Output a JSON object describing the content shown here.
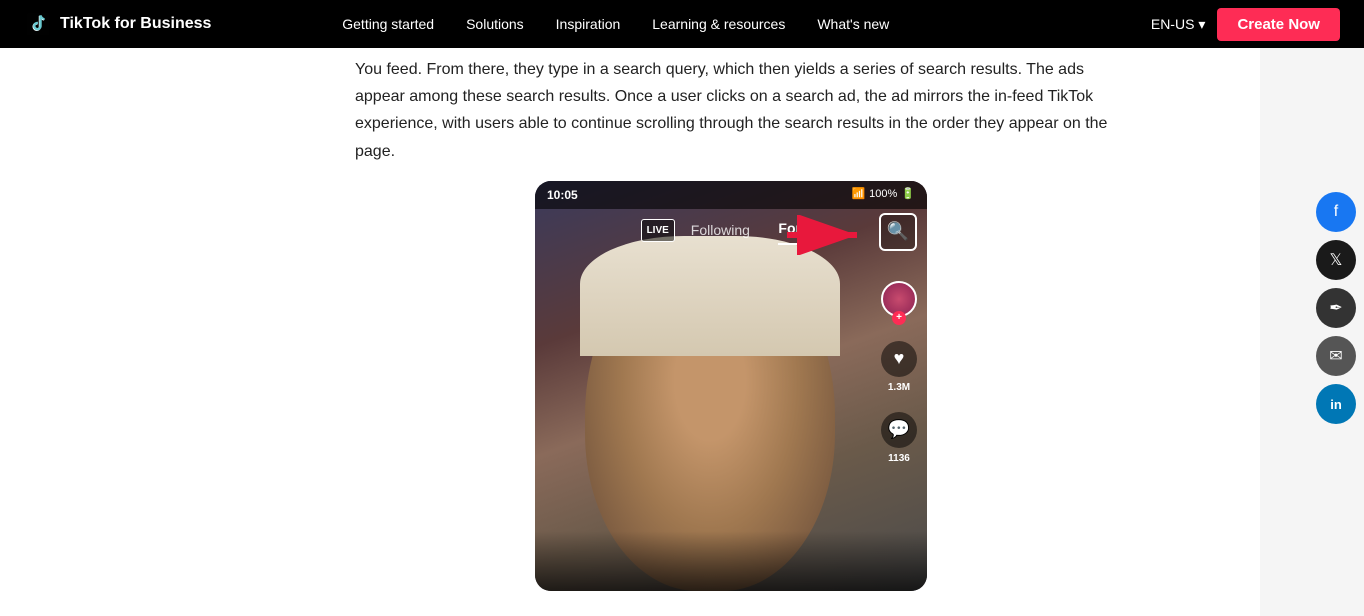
{
  "nav": {
    "logo_text": "TikTok for Business",
    "links": [
      {
        "label": "Getting started",
        "id": "getting-started"
      },
      {
        "label": "Solutions",
        "id": "solutions"
      },
      {
        "label": "Inspiration",
        "id": "inspiration"
      },
      {
        "label": "Learning & resources",
        "id": "learning-resources"
      },
      {
        "label": "What's new",
        "id": "whats-new"
      }
    ],
    "lang": "EN-US",
    "create_btn": "Create Now"
  },
  "article": {
    "paragraph1": "You feed. From there, they type in a search query, which then yields a series of search results. The ads appear among these search results. Once a user clicks on a search ad, the ad mirrors the in-feed TikTok experience, with users able to continue scrolling through the search results in the order they appear on the page."
  },
  "phone": {
    "status_time": "10:05",
    "status_battery": "100%",
    "live_badge": "LIVE",
    "following": "Following",
    "for_you": "For Yo",
    "likes": "1.3M",
    "comments": "1136"
  },
  "social": {
    "icons": [
      {
        "name": "facebook",
        "symbol": "f"
      },
      {
        "name": "twitter",
        "symbol": "𝕏"
      },
      {
        "name": "link",
        "symbol": "✏"
      },
      {
        "name": "email",
        "symbol": "✉"
      },
      {
        "name": "linkedin",
        "symbol": "in"
      }
    ]
  }
}
